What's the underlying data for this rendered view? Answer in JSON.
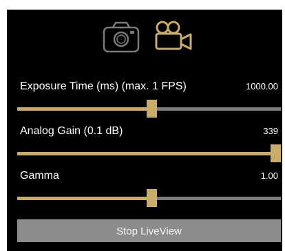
{
  "colors": {
    "panel_bg": "#000000",
    "accent": "#c9ac6a",
    "track": "#7d7d7d",
    "inactive_icon": "#7a7a7a",
    "button_bg": "#8c8c8c"
  },
  "mode_icons": [
    {
      "name": "camera-icon",
      "active": false
    },
    {
      "name": "video-camera-icon",
      "active": true
    }
  ],
  "sliders": [
    {
      "label": "Exposure Time (ms) (max. 1 FPS)",
      "value_text": "1000.00",
      "fraction": 0.51
    },
    {
      "label": "Analog Gain (0.1 dB)",
      "value_text": "339",
      "fraction": 1.0
    },
    {
      "label": "Gamma",
      "value_text": "1.00",
      "fraction": 0.51
    }
  ],
  "button": {
    "label": "Stop LiveView"
  }
}
